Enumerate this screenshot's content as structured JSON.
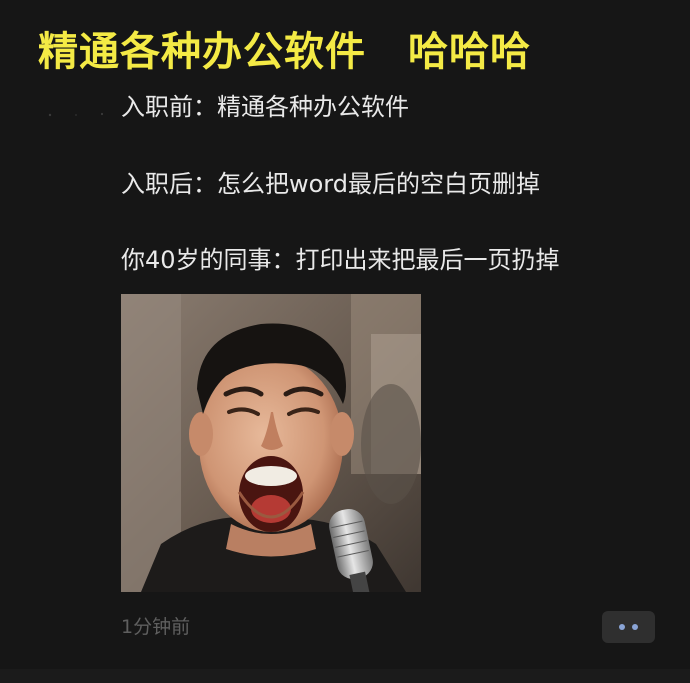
{
  "headline": {
    "title": "精通各种办公软件",
    "laugh": "哈哈哈",
    "color": "#f4ea45"
  },
  "post": {
    "lines": [
      "入职前：精通各种办公软件",
      "入职后：怎么把word最后的空白页删掉",
      "你40岁的同事：打印出来把最后一页扔掉"
    ],
    "image_icon": "screaming-man-meme-image",
    "timestamp": "1分钟前",
    "more_icon": "more-dots-icon",
    "accent_color": "#8aa4d6"
  }
}
